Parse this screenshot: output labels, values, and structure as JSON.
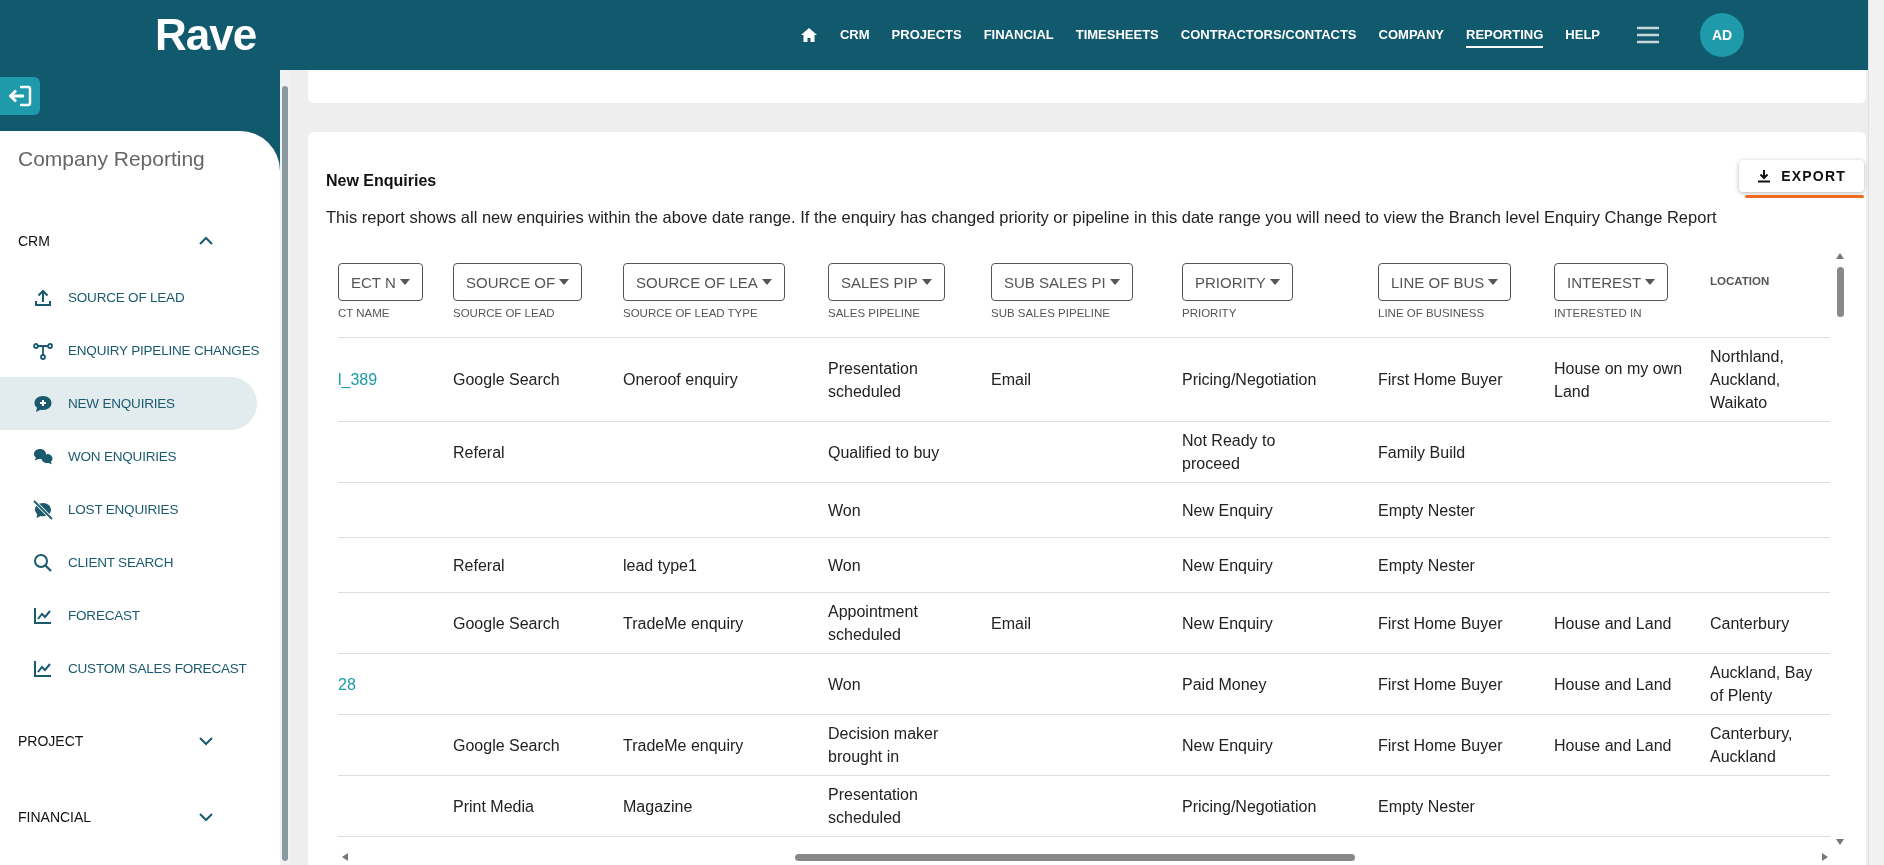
{
  "header": {
    "logo": "Rave",
    "nav": [
      {
        "label": "CRM",
        "selected": false
      },
      {
        "label": "PROJECTS",
        "selected": false
      },
      {
        "label": "FINANCIAL",
        "selected": false
      },
      {
        "label": "TIMESHEETS",
        "selected": false
      },
      {
        "label": "CONTRACTORS/CONTACTS",
        "selected": false
      },
      {
        "label": "COMPANY",
        "selected": false
      },
      {
        "label": "REPORTING",
        "selected": true
      },
      {
        "label": "HELP",
        "selected": false
      }
    ],
    "avatar": "AD"
  },
  "sidebar": {
    "title": "Company Reporting",
    "sections": [
      {
        "label": "CRM",
        "expanded": true,
        "items": [
          {
            "label": "SOURCE OF LEAD",
            "selected": false
          },
          {
            "label": "ENQUIRY PIPELINE CHANGES",
            "selected": false
          },
          {
            "label": "NEW ENQUIRIES",
            "selected": true
          },
          {
            "label": "WON ENQUIRIES",
            "selected": false
          },
          {
            "label": "LOST ENQUIRIES",
            "selected": false
          },
          {
            "label": "CLIENT SEARCH",
            "selected": false
          },
          {
            "label": "FORECAST",
            "selected": false
          },
          {
            "label": "CUSTOM SALES FORECAST",
            "selected": false
          }
        ]
      },
      {
        "label": "PROJECT",
        "expanded": false
      },
      {
        "label": "FINANCIAL",
        "expanded": false
      }
    ]
  },
  "report": {
    "title": "New Enquiries",
    "export_label": "EXPORT",
    "description": "This report shows all new enquiries within the above date range. If the enquiry has changed priority or pipeline in this date range you will need to view the Branch level Enquiry Change Report",
    "columns": [
      {
        "filter": "ECT N",
        "label": "CT NAME"
      },
      {
        "filter": "SOURCE OF",
        "label": "SOURCE OF LEAD"
      },
      {
        "filter": "SOURCE OF LEA",
        "label": "SOURCE OF LEAD TYPE"
      },
      {
        "filter": "SALES PIP",
        "label": "SALES PIPELINE"
      },
      {
        "filter": "SUB SALES PI",
        "label": "SUB SALES PIPELINE"
      },
      {
        "filter": "PRIORITY",
        "label": "PRIORITY"
      },
      {
        "filter": "LINE OF BUS",
        "label": "LINE OF BUSINESS"
      },
      {
        "filter": "INTEREST",
        "label": "INTERESTED IN"
      },
      {
        "label": "LOCATION"
      }
    ],
    "rows": [
      {
        "cells": [
          "l_389",
          "Google Search",
          "Oneroof enquiry",
          "Presentation scheduled",
          "Email",
          "Pricing/Negotiation",
          "First Home Buyer",
          "House on my own Land",
          "Northland, Auckland, Waikato"
        ]
      },
      {
        "cells": [
          null,
          "Referal",
          null,
          "Qualified to buy",
          null,
          "Not Ready to proceed",
          "Family Build",
          null,
          null
        ]
      },
      {
        "cells": [
          null,
          null,
          null,
          "Won",
          null,
          "New Enquiry",
          "Empty Nester",
          null,
          null
        ]
      },
      {
        "cells": [
          null,
          "Referal",
          "lead type1",
          "Won",
          null,
          "New Enquiry",
          "Empty Nester",
          null,
          null
        ]
      },
      {
        "cells": [
          null,
          "Google Search",
          "TradeMe enquiry",
          "Appointment scheduled",
          "Email",
          "New Enquiry",
          "First Home Buyer",
          "House and Land",
          "Canterbury"
        ]
      },
      {
        "cells": [
          "28",
          null,
          null,
          "Won",
          null,
          "Paid Money",
          "First Home Buyer",
          "House and Land",
          "Auckland, Bay of Plenty"
        ]
      },
      {
        "cells": [
          null,
          "Google Search",
          "TradeMe enquiry",
          "Decision maker brought in",
          null,
          "New Enquiry",
          "First Home Buyer",
          "House and Land",
          "Canterbury, Auckland"
        ]
      },
      {
        "cells": [
          null,
          "Print Media",
          "Magazine",
          "Presentation scheduled",
          null,
          "Pricing/Negotiation",
          "Empty Nester",
          null,
          null
        ]
      }
    ]
  }
}
